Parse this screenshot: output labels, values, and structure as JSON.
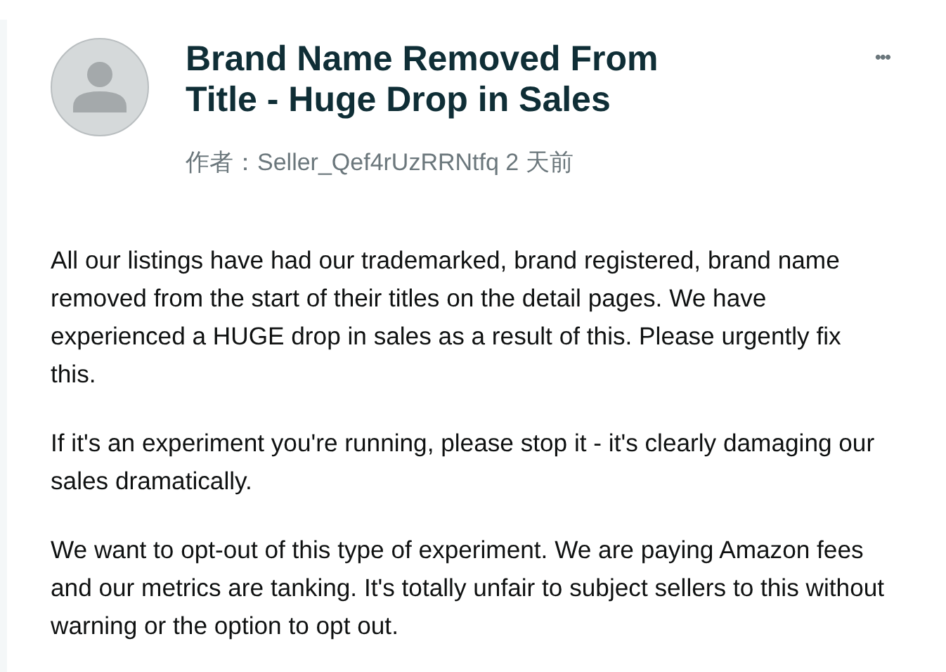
{
  "post": {
    "title": "Brand Name Removed From Title - Huge Drop in Sales",
    "author_label": "作者：Seller_Qef4rUzRRNtfq 2 天前",
    "menu": "•••",
    "paragraphs": [
      "All our listings have had our trademarked, brand registered, brand name removed from the start of their titles on the detail pages. We have experienced a HUGE drop in sales as a result of this. Please urgently fix this.",
      "If it's an experiment you're running, please stop it - it's clearly damaging our sales dramatically.",
      "We want to opt-out of this type of experiment. We are paying Amazon fees and our metrics are tanking. It's totally unfair to subject sellers to this without warning or the option to opt out."
    ]
  }
}
